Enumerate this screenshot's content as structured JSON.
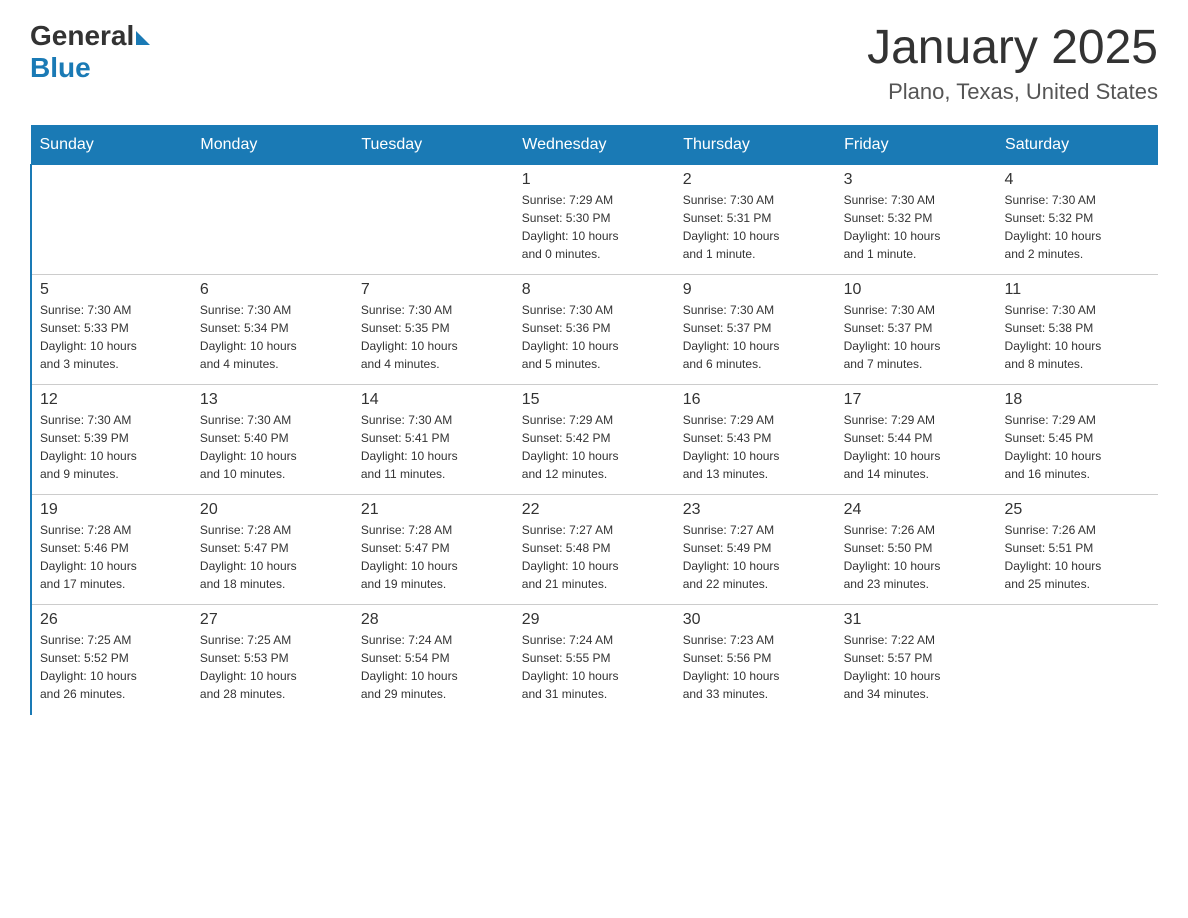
{
  "logo": {
    "text_general": "General",
    "text_blue": "Blue",
    "arrow": "▶"
  },
  "title": "January 2025",
  "subtitle": "Plano, Texas, United States",
  "headers": [
    "Sunday",
    "Monday",
    "Tuesday",
    "Wednesday",
    "Thursday",
    "Friday",
    "Saturday"
  ],
  "weeks": [
    [
      {
        "day": "",
        "info": ""
      },
      {
        "day": "",
        "info": ""
      },
      {
        "day": "",
        "info": ""
      },
      {
        "day": "1",
        "info": "Sunrise: 7:29 AM\nSunset: 5:30 PM\nDaylight: 10 hours\nand 0 minutes."
      },
      {
        "day": "2",
        "info": "Sunrise: 7:30 AM\nSunset: 5:31 PM\nDaylight: 10 hours\nand 1 minute."
      },
      {
        "day": "3",
        "info": "Sunrise: 7:30 AM\nSunset: 5:32 PM\nDaylight: 10 hours\nand 1 minute."
      },
      {
        "day": "4",
        "info": "Sunrise: 7:30 AM\nSunset: 5:32 PM\nDaylight: 10 hours\nand 2 minutes."
      }
    ],
    [
      {
        "day": "5",
        "info": "Sunrise: 7:30 AM\nSunset: 5:33 PM\nDaylight: 10 hours\nand 3 minutes."
      },
      {
        "day": "6",
        "info": "Sunrise: 7:30 AM\nSunset: 5:34 PM\nDaylight: 10 hours\nand 4 minutes."
      },
      {
        "day": "7",
        "info": "Sunrise: 7:30 AM\nSunset: 5:35 PM\nDaylight: 10 hours\nand 4 minutes."
      },
      {
        "day": "8",
        "info": "Sunrise: 7:30 AM\nSunset: 5:36 PM\nDaylight: 10 hours\nand 5 minutes."
      },
      {
        "day": "9",
        "info": "Sunrise: 7:30 AM\nSunset: 5:37 PM\nDaylight: 10 hours\nand 6 minutes."
      },
      {
        "day": "10",
        "info": "Sunrise: 7:30 AM\nSunset: 5:37 PM\nDaylight: 10 hours\nand 7 minutes."
      },
      {
        "day": "11",
        "info": "Sunrise: 7:30 AM\nSunset: 5:38 PM\nDaylight: 10 hours\nand 8 minutes."
      }
    ],
    [
      {
        "day": "12",
        "info": "Sunrise: 7:30 AM\nSunset: 5:39 PM\nDaylight: 10 hours\nand 9 minutes."
      },
      {
        "day": "13",
        "info": "Sunrise: 7:30 AM\nSunset: 5:40 PM\nDaylight: 10 hours\nand 10 minutes."
      },
      {
        "day": "14",
        "info": "Sunrise: 7:30 AM\nSunset: 5:41 PM\nDaylight: 10 hours\nand 11 minutes."
      },
      {
        "day": "15",
        "info": "Sunrise: 7:29 AM\nSunset: 5:42 PM\nDaylight: 10 hours\nand 12 minutes."
      },
      {
        "day": "16",
        "info": "Sunrise: 7:29 AM\nSunset: 5:43 PM\nDaylight: 10 hours\nand 13 minutes."
      },
      {
        "day": "17",
        "info": "Sunrise: 7:29 AM\nSunset: 5:44 PM\nDaylight: 10 hours\nand 14 minutes."
      },
      {
        "day": "18",
        "info": "Sunrise: 7:29 AM\nSunset: 5:45 PM\nDaylight: 10 hours\nand 16 minutes."
      }
    ],
    [
      {
        "day": "19",
        "info": "Sunrise: 7:28 AM\nSunset: 5:46 PM\nDaylight: 10 hours\nand 17 minutes."
      },
      {
        "day": "20",
        "info": "Sunrise: 7:28 AM\nSunset: 5:47 PM\nDaylight: 10 hours\nand 18 minutes."
      },
      {
        "day": "21",
        "info": "Sunrise: 7:28 AM\nSunset: 5:47 PM\nDaylight: 10 hours\nand 19 minutes."
      },
      {
        "day": "22",
        "info": "Sunrise: 7:27 AM\nSunset: 5:48 PM\nDaylight: 10 hours\nand 21 minutes."
      },
      {
        "day": "23",
        "info": "Sunrise: 7:27 AM\nSunset: 5:49 PM\nDaylight: 10 hours\nand 22 minutes."
      },
      {
        "day": "24",
        "info": "Sunrise: 7:26 AM\nSunset: 5:50 PM\nDaylight: 10 hours\nand 23 minutes."
      },
      {
        "day": "25",
        "info": "Sunrise: 7:26 AM\nSunset: 5:51 PM\nDaylight: 10 hours\nand 25 minutes."
      }
    ],
    [
      {
        "day": "26",
        "info": "Sunrise: 7:25 AM\nSunset: 5:52 PM\nDaylight: 10 hours\nand 26 minutes."
      },
      {
        "day": "27",
        "info": "Sunrise: 7:25 AM\nSunset: 5:53 PM\nDaylight: 10 hours\nand 28 minutes."
      },
      {
        "day": "28",
        "info": "Sunrise: 7:24 AM\nSunset: 5:54 PM\nDaylight: 10 hours\nand 29 minutes."
      },
      {
        "day": "29",
        "info": "Sunrise: 7:24 AM\nSunset: 5:55 PM\nDaylight: 10 hours\nand 31 minutes."
      },
      {
        "day": "30",
        "info": "Sunrise: 7:23 AM\nSunset: 5:56 PM\nDaylight: 10 hours\nand 33 minutes."
      },
      {
        "day": "31",
        "info": "Sunrise: 7:22 AM\nSunset: 5:57 PM\nDaylight: 10 hours\nand 34 minutes."
      },
      {
        "day": "",
        "info": ""
      }
    ]
  ]
}
